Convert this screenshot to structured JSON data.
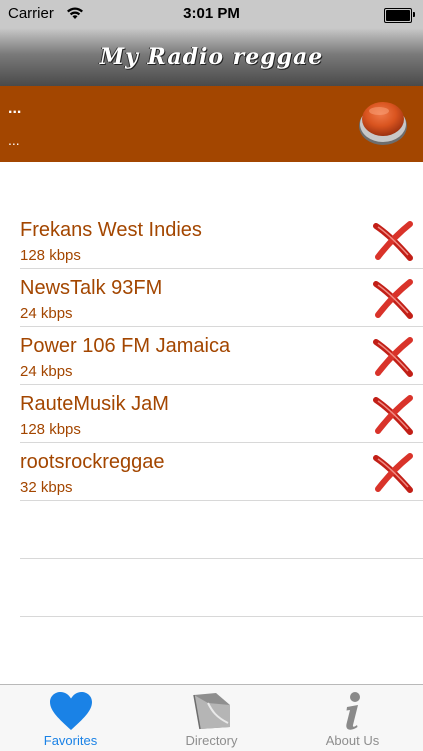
{
  "status_bar": {
    "carrier": "Carrier",
    "time": "3:01 PM"
  },
  "nav": {
    "title": "My Radio reggae"
  },
  "player": {
    "line1": "...",
    "line2": "..."
  },
  "stations": [
    {
      "name": "Frekans West Indies",
      "bitrate": "128 kbps"
    },
    {
      "name": "NewsTalk 93FM",
      "bitrate": "24 kbps"
    },
    {
      "name": "Power 106 FM Jamaica",
      "bitrate": "24 kbps"
    },
    {
      "name": "RauteMusik JaM",
      "bitrate": "128 kbps"
    },
    {
      "name": "rootsrockreggae",
      "bitrate": "32 kbps"
    }
  ],
  "tabs": [
    {
      "label": "Favorites",
      "icon": "heart-icon",
      "active": true
    },
    {
      "label": "Directory",
      "icon": "folder-icon",
      "active": false
    },
    {
      "label": "About Us",
      "icon": "info-icon",
      "active": false
    }
  ],
  "colors": {
    "accent": "#a34600",
    "tab_active": "#1a82e6",
    "delete_red": "#d0241c"
  }
}
